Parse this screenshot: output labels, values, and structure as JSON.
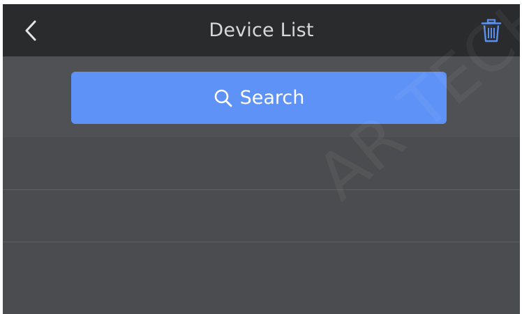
{
  "header": {
    "title": "Device List",
    "back_icon": "chevron-left-icon",
    "delete_icon": "trash-icon"
  },
  "search": {
    "label": "Search",
    "icon": "search-icon"
  },
  "device_list": {
    "items": [
      "",
      "",
      ""
    ]
  },
  "watermark": {
    "text": "AR TECH"
  },
  "colors": {
    "header_bg": "#2a2b2d",
    "body_bg": "#4c4e51",
    "accent": "#5f92f6",
    "trash_icon": "#5a8ff0"
  }
}
